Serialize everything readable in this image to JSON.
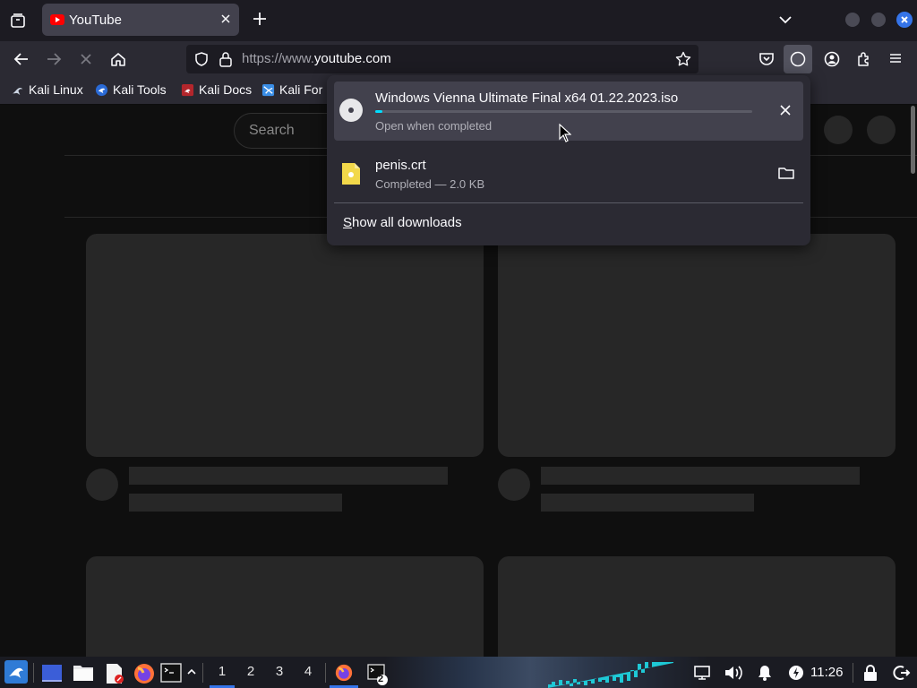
{
  "browser": {
    "tab": {
      "title": "YouTube"
    },
    "url": {
      "prefix": "https://www.",
      "domain": "youtube.com"
    },
    "bookmarks": [
      "Kali Linux",
      "Kali Tools",
      "Kali Docs",
      "Kali For"
    ]
  },
  "page": {
    "search_placeholder": "Search"
  },
  "downloads": {
    "items": [
      {
        "name": "Windows Vienna Ultimate Final x64 01.22.2023.iso",
        "status": "Open when completed",
        "progress": 0.02
      },
      {
        "name": "penis.crt",
        "status": "Completed — 2.0 KB"
      }
    ],
    "show_all_label": "Show all downloads",
    "show_all_underline_char": "S",
    "show_all_rest": "how all downloads"
  },
  "taskbar": {
    "workspaces": [
      "1",
      "2",
      "3",
      "4"
    ],
    "terminal_badge": "2",
    "clock": "11:26"
  },
  "colors": {
    "accent": "#3574e9",
    "progress": "#00ddff",
    "youtube_red": "#ff0000"
  }
}
